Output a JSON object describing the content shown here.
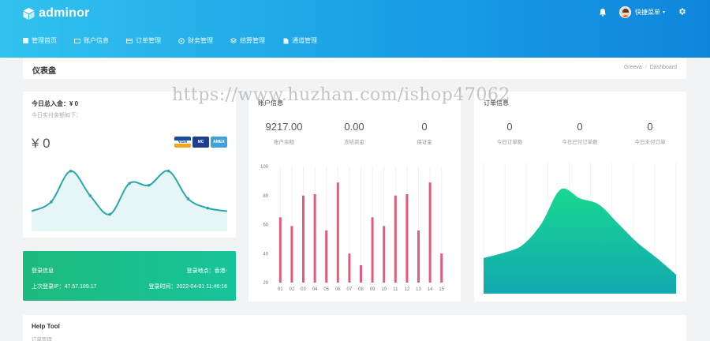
{
  "app": {
    "logo_text": "adminor",
    "user_menu_label": "快捷菜单",
    "colors": {
      "header_start": "#32c2ef",
      "header_end": "#0f86dc",
      "accent_green": "#1dba7e",
      "bar": "#e35b7a",
      "line": "#2ba7a9"
    }
  },
  "nav": [
    {
      "label": "管理首页",
      "icon": "dashboard-icon"
    },
    {
      "label": "账户信息",
      "icon": "user-icon"
    },
    {
      "label": "订单管理",
      "icon": "order-icon"
    },
    {
      "label": "财务管理",
      "icon": "finance-icon"
    },
    {
      "label": "结算管理",
      "icon": "settle-icon"
    },
    {
      "label": "通道管理",
      "icon": "channel-icon"
    }
  ],
  "page": {
    "title": "仪表盘",
    "breadcrumb": [
      "Greeva",
      "Dashboard"
    ]
  },
  "income_card": {
    "title": "今日总入金：¥ 0",
    "subtitle": "今日实付金额如下：",
    "balance": "¥ 0",
    "cards": [
      "VISA",
      "MC",
      "AMEX"
    ]
  },
  "login_info": {
    "title": "登录信息",
    "location": "登录地点：香港-",
    "last_ip": "上次登录IP：47.57.189.17",
    "time": "登录时间：2022-04-01 11:46:16"
  },
  "account_card": {
    "title": "账户信息",
    "stats": [
      {
        "value": "9217.00",
        "label": "账户余额"
      },
      {
        "value": "0.00",
        "label": "冻结资金"
      },
      {
        "value": "0",
        "label": "保证金"
      }
    ]
  },
  "order_card": {
    "title": "订单信息",
    "stats": [
      {
        "value": "0",
        "label": "今日订单数"
      },
      {
        "value": "0",
        "label": "今日已付订单数"
      },
      {
        "value": "0",
        "label": "今日未付订单"
      }
    ]
  },
  "help": {
    "title": "Help Tool",
    "subtitle": "订单管理"
  },
  "watermark": "https://www.huzhan.com/ishop47062",
  "chart_data": [
    {
      "type": "line",
      "x": [
        1,
        2,
        3,
        4,
        5,
        6,
        7,
        8,
        9,
        10,
        11
      ],
      "values": [
        30,
        45,
        95,
        55,
        25,
        75,
        72,
        95,
        50,
        35,
        30
      ],
      "ylim": [
        0,
        110
      ],
      "grid": false
    },
    {
      "type": "bar",
      "categories": [
        "01",
        "02",
        "03",
        "04",
        "05",
        "06",
        "07",
        "08",
        "09",
        "10",
        "11",
        "12",
        "13",
        "14",
        "15"
      ],
      "values": [
        65,
        59,
        80,
        81,
        56,
        89,
        40,
        32,
        65,
        59,
        80,
        81,
        56,
        89,
        40
      ],
      "ylim": [
        20,
        100
      ],
      "yticks": [
        20,
        40,
        60,
        80,
        100
      ],
      "grid": true
    },
    {
      "type": "area",
      "x": [
        0,
        1,
        2,
        3,
        4,
        5,
        6,
        7,
        8,
        9,
        10
      ],
      "values": [
        28,
        32,
        38,
        55,
        82,
        75,
        70,
        55,
        40,
        28,
        15
      ],
      "ylim": [
        0,
        100
      ],
      "grid": true
    }
  ]
}
